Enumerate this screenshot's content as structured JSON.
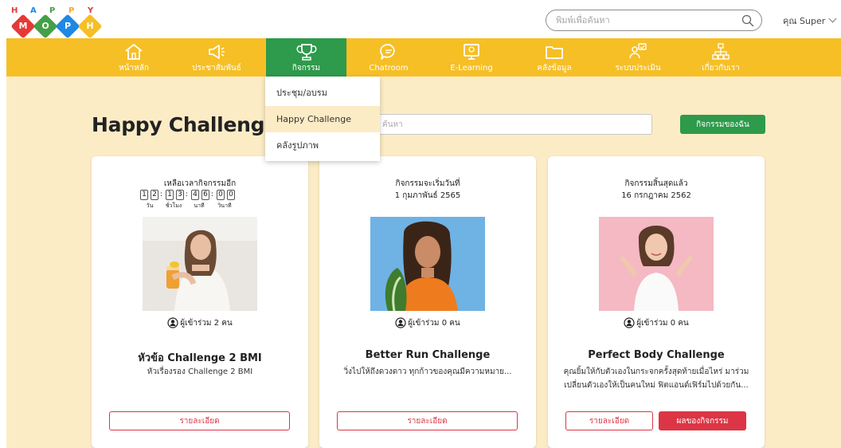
{
  "logo": {
    "top_letters": [
      "H",
      "A",
      "P",
      "P",
      "Y"
    ],
    "bottom_letters": [
      "M",
      "O",
      "P",
      "H"
    ],
    "letter_colors": [
      "#e53935",
      "#1e88e5",
      "#43a047",
      "#f9a825",
      "#e53935"
    ],
    "diamond_colors": [
      "#e53935",
      "#43a047",
      "#1e88e5",
      "#f6bf26"
    ]
  },
  "search": {
    "placeholder": "พิมพ์เพื่อค้นหา",
    "icon": "magnifier-icon"
  },
  "user": {
    "label": "คุณ Super"
  },
  "nav": {
    "items": [
      {
        "label": "หน้าหลัก",
        "icon": "home-icon"
      },
      {
        "label": "ประชาสัมพันธ์",
        "icon": "megaphone-icon"
      },
      {
        "label": "กิจกรรม",
        "icon": "trophy-icon",
        "active": true
      },
      {
        "label": "Chatroom",
        "icon": "chat-icon"
      },
      {
        "label": "E-Learning",
        "icon": "monitor-icon"
      },
      {
        "label": "คลังข้อมูล",
        "icon": "folder-icon"
      },
      {
        "label": "ระบบประเมิน",
        "icon": "evaluation-icon"
      },
      {
        "label": "เกี่ยวกับเรา",
        "icon": "org-chart-icon"
      }
    ]
  },
  "dropdown": {
    "items": [
      {
        "label": "ประชุม/อบรม"
      },
      {
        "label": "Happy Challenge",
        "highlighted": true
      },
      {
        "label": "คลังรูปภาพ"
      }
    ]
  },
  "page": {
    "title": "Happy Challenge",
    "filter_placeholder": "ค้นหา",
    "my_activity_label": "กิจกรรมของฉัน"
  },
  "cards": [
    {
      "status": "เหลือเวลากิจกรรมอีก",
      "countdown": {
        "digits": [
          "1",
          "2",
          "1",
          "3",
          "4",
          "6",
          "0",
          "0"
        ],
        "units": [
          "วัน",
          "ชั่วโมง",
          "นาที",
          "วินาที"
        ]
      },
      "participants": "ผู้เข้าร่วม 2 คน",
      "title": "หัวข้อ Challenge 2 BMI",
      "description": "หัวเรื่องรอง Challenge 2 BMI",
      "detail_label": "รายละเอียด"
    },
    {
      "status": "กิจกรรมจะเริ่มวันที่",
      "date": "1 กุมภาพันธ์ 2565",
      "participants": "ผู้เข้าร่วม 0 คน",
      "title": "Better Run Challenge",
      "description": "วิ่งไปให้ถึงดวงดาว ทุกก้าวของคุณมีความหมาย...",
      "detail_label": "รายละเอียด"
    },
    {
      "status": "กิจกรรมสิ้นสุดแล้ว",
      "date": "16 กรกฎาคม 2562",
      "participants": "ผู้เข้าร่วม 0 คน",
      "title": "Perfect Body Challenge",
      "description": "คุณยิ้มให้กับตัวเองในกระจกครั้งสุดท้ายเมื่อไหร่ มาร่วมเปลี่ยนตัวเองให้เป็นคนใหม่ ฟิตแอนด์เฟิร์มไปด้วยกัน...",
      "detail_label": "รายละเอียด",
      "result_label": "ผลของกิจกรรม"
    }
  ],
  "colors": {
    "nav_bg": "#f6bf26",
    "nav_active": "#2e9a4b",
    "main_bg": "#fcecc6",
    "accent_red": "#dc3545",
    "accent_green": "#2e9a4b"
  }
}
